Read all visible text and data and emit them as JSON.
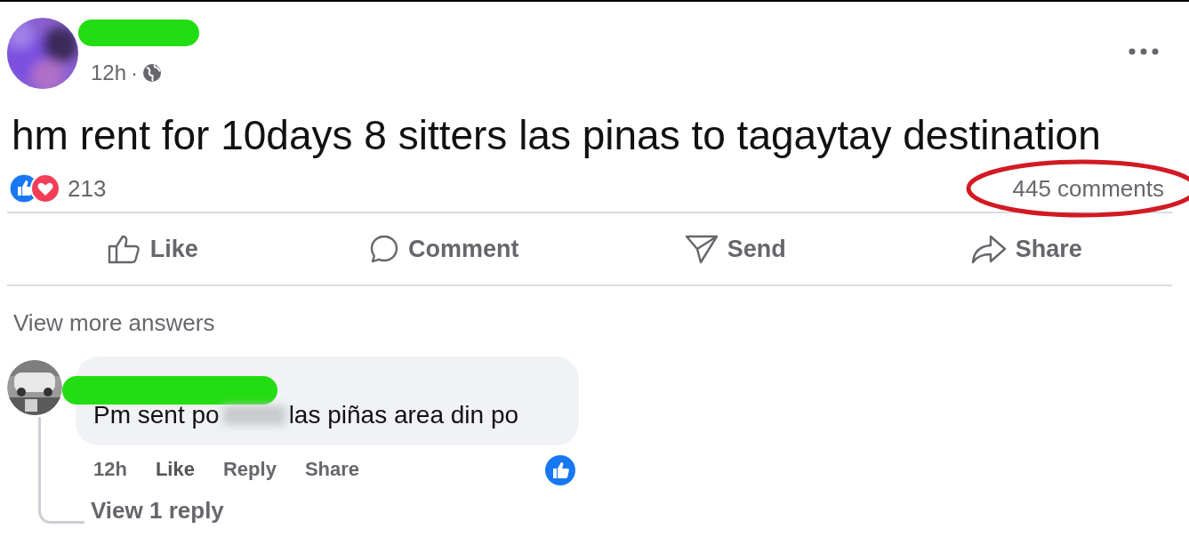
{
  "post": {
    "time": "12h",
    "separator": "·",
    "text": "hm rent for 10days 8 sitters las pinas to tagaytay destination",
    "reactions_count": "213",
    "comments_count": "445 comments",
    "actions": [
      {
        "kind": "like",
        "label": "Like"
      },
      {
        "kind": "comment",
        "label": "Comment"
      },
      {
        "kind": "send",
        "label": "Send"
      },
      {
        "kind": "share",
        "label": "Share"
      }
    ]
  },
  "comments_section": {
    "view_more": "View more answers",
    "comments": [
      {
        "text_before": "Pm sent po",
        "text_after": "las piñas area din po",
        "time": "12h",
        "actions": [
          "Like",
          "Reply",
          "Share"
        ],
        "view_replies": "View 1 reply"
      }
    ]
  }
}
